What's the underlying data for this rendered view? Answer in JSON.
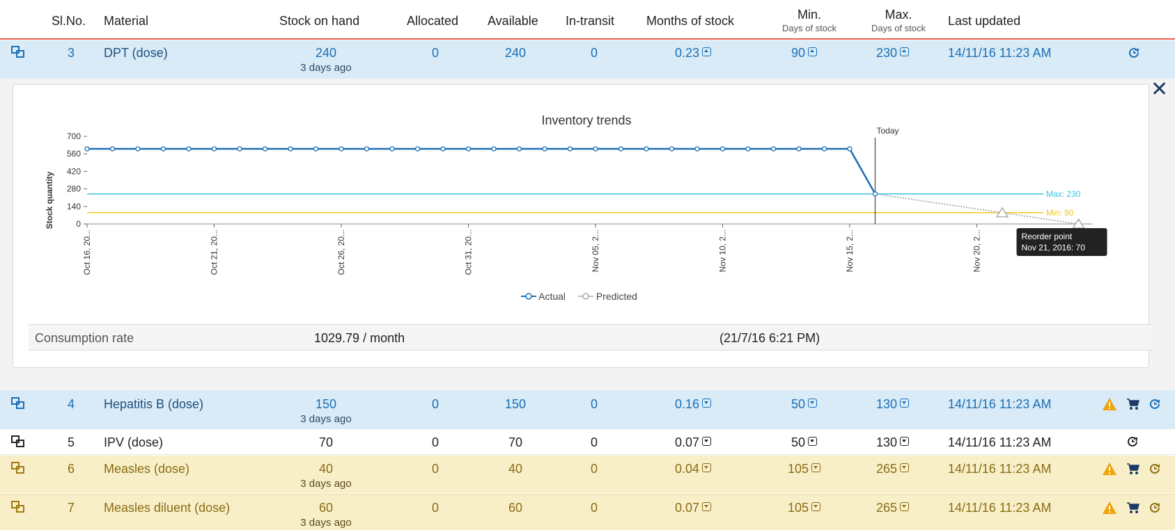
{
  "header": {
    "slno": "Sl.No.",
    "material": "Material",
    "stock_on_hand": "Stock on hand",
    "allocated": "Allocated",
    "available": "Available",
    "in_transit": "In-transit",
    "months_of_stock": "Months of stock",
    "min": "Min.",
    "min_sub": "Days of stock",
    "max": "Max.",
    "max_sub": "Days of stock",
    "last_updated": "Last updated"
  },
  "rows": [
    {
      "slno": "3",
      "material": "DPT (dose)",
      "stock": "240",
      "ago": "3 days ago",
      "allocated": "0",
      "available": "240",
      "in_transit": "0",
      "months": "0.23",
      "min": "90",
      "max": "230",
      "updated": "14/11/16 11:23 AM",
      "style": "blue"
    },
    {
      "slno": "4",
      "material": "Hepatitis B (dose)",
      "stock": "150",
      "ago": "3 days ago",
      "allocated": "0",
      "available": "150",
      "in_transit": "0",
      "months": "0.16",
      "min": "50",
      "max": "130",
      "updated": "14/11/16 11:23 AM",
      "style": "blue"
    },
    {
      "slno": "5",
      "material": "IPV (dose)",
      "stock": "70",
      "ago": "",
      "allocated": "0",
      "available": "70",
      "in_transit": "0",
      "months": "0.07",
      "min": "50",
      "max": "130",
      "updated": "14/11/16 11:23 AM",
      "style": "white"
    },
    {
      "slno": "6",
      "material": "Measles (dose)",
      "stock": "40",
      "ago": "3 days ago",
      "allocated": "0",
      "available": "40",
      "in_transit": "0",
      "months": "0.04",
      "min": "105",
      "max": "265",
      "updated": "14/11/16 11:23 AM",
      "style": "yellow"
    },
    {
      "slno": "7",
      "material": "Measles diluent (dose)",
      "stock": "60",
      "ago": "3 days ago",
      "allocated": "0",
      "available": "60",
      "in_transit": "0",
      "months": "0.07",
      "min": "105",
      "max": "265",
      "updated": "14/11/16 11:23 AM",
      "style": "yellow"
    }
  ],
  "panel": {
    "close_glyph": "✕",
    "consumption_label": "Consumption rate",
    "consumption_value": "1029.79 / month",
    "consumption_time": "(21/7/16 6:21 PM)"
  },
  "colors": {
    "actual": "#1a6fb5",
    "predicted": "#aaaaaa",
    "max_line": "#3cc3e6",
    "min_line": "#f2c81e",
    "warning": "#f0a30a",
    "cart": "#1b3a66"
  },
  "icons": {
    "expand": "expand-rows-icon",
    "history": "history-icon",
    "warning": "warning-icon",
    "cart": "cart-icon"
  },
  "chart_data": {
    "type": "line",
    "title": "Inventory trends",
    "ylabel": "Stock quantity",
    "xlabel": "",
    "ylim": [
      0,
      700
    ],
    "yticks": [
      0,
      140,
      280,
      420,
      560,
      700
    ],
    "xtick_labels": [
      "Oct 16, 20...",
      "Oct 21, 20...",
      "Oct 26, 20...",
      "Oct 31, 20...",
      "Nov 05, 2...",
      "Nov 10, 2...",
      "Nov 15, 2...",
      "Nov 20, 2..."
    ],
    "series": [
      {
        "name": "Actual",
        "x_start": "2016-10-16",
        "values": [
          600,
          600,
          600,
          600,
          600,
          600,
          600,
          600,
          600,
          600,
          600,
          600,
          600,
          600,
          600,
          600,
          600,
          600,
          600,
          600,
          600,
          600,
          600,
          600,
          600,
          600,
          600,
          600,
          600,
          600,
          600,
          240
        ]
      },
      {
        "name": "Predicted",
        "x": [
          "2016-11-16",
          "2016-11-21",
          "2016-11-24"
        ],
        "values": [
          240,
          90,
          0
        ]
      }
    ],
    "reference_lines": [
      {
        "label": "Max: 230",
        "value": 240
      },
      {
        "label": "Min: 90",
        "value": 90
      }
    ],
    "today_label": "Today",
    "legend": [
      "Actual",
      "Predicted"
    ],
    "tooltip": {
      "title": "Reorder point",
      "text": "Nov 21, 2016: 70"
    }
  }
}
